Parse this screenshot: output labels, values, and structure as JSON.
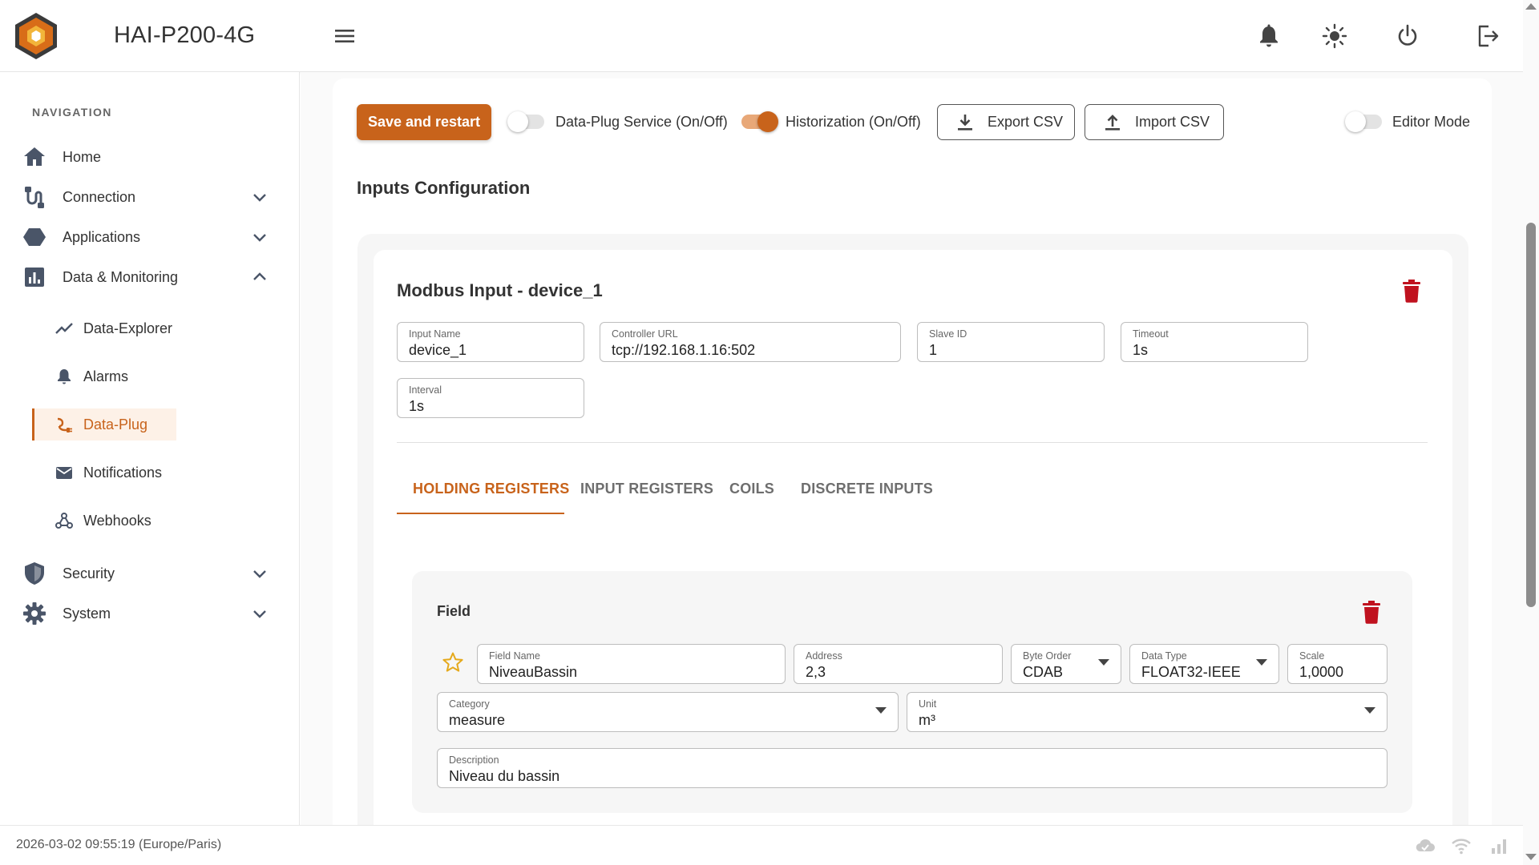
{
  "app": {
    "title": "HAI-P200-4G"
  },
  "header": {
    "icons": [
      "menu-icon",
      "bell-icon",
      "sun-icon",
      "power-icon",
      "logout-icon"
    ]
  },
  "sidebar": {
    "heading": "NAVIGATION",
    "items": [
      {
        "label": "Home",
        "icon": "home-icon"
      },
      {
        "label": "Connection",
        "icon": "connection-icon"
      },
      {
        "label": "Applications",
        "icon": "hexagon-icon"
      },
      {
        "label": "Data & Monitoring",
        "icon": "chart-icon"
      },
      {
        "label": "Security",
        "icon": "shield-icon"
      },
      {
        "label": "System",
        "icon": "gear-icon"
      }
    ],
    "subitems": [
      {
        "label": "Data-Explorer",
        "icon": "trend-icon"
      },
      {
        "label": "Alarms",
        "icon": "bell-icon"
      },
      {
        "label": "Data-Plug",
        "icon": "plug-icon",
        "active": true
      },
      {
        "label": "Notifications",
        "icon": "mail-icon"
      },
      {
        "label": "Webhooks",
        "icon": "webhook-icon"
      }
    ]
  },
  "toolbar": {
    "save_label": "Save and restart",
    "dataplug_toggle_label": "Data-Plug Service (On/Off)",
    "dataplug_on": false,
    "historization_toggle_label": "Historization (On/Off)",
    "historization_on": true,
    "export_label": "Export CSV",
    "import_label": "Import CSV",
    "editor_toggle_label": "Editor Mode",
    "editor_on": false
  },
  "page": {
    "section_title": "Inputs Configuration"
  },
  "input": {
    "title": "Modbus Input - device_1",
    "fields": {
      "input_name": {
        "label": "Input Name",
        "value": "device_1"
      },
      "controller_url": {
        "label": "Controller URL",
        "value": "tcp://192.168.1.16:502"
      },
      "slave_id": {
        "label": "Slave ID",
        "value": "1"
      },
      "timeout": {
        "label": "Timeout",
        "value": "1s"
      },
      "interval": {
        "label": "Interval",
        "value": "1s"
      }
    },
    "tabs": [
      "HOLDING REGISTERS",
      "INPUT REGISTERS",
      "COILS",
      "DISCRETE INPUTS"
    ],
    "active_tab": "HOLDING REGISTERS"
  },
  "field": {
    "title": "Field",
    "field_name": {
      "label": "Field Name",
      "value": "NiveauBassin"
    },
    "address": {
      "label": "Address",
      "value": "2,3"
    },
    "byte_order": {
      "label": "Byte Order",
      "value": "CDAB"
    },
    "data_type": {
      "label": "Data Type",
      "value": "FLOAT32-IEEE"
    },
    "scale": {
      "label": "Scale",
      "value": "1,0000"
    },
    "category": {
      "label": "Category",
      "value": "measure"
    },
    "unit": {
      "label": "Unit",
      "value": "m³"
    },
    "description": {
      "label": "Description",
      "value": "Niveau du bassin"
    }
  },
  "footer": {
    "datetime": "2026-03-02 09:55:19 (Europe/Paris)",
    "icons": [
      "cloud-sync-icon",
      "wifi-icon",
      "signal-icon"
    ]
  },
  "colors": {
    "accent": "#c8631b",
    "danger": "#c0121f",
    "star": "#e5a91b"
  }
}
